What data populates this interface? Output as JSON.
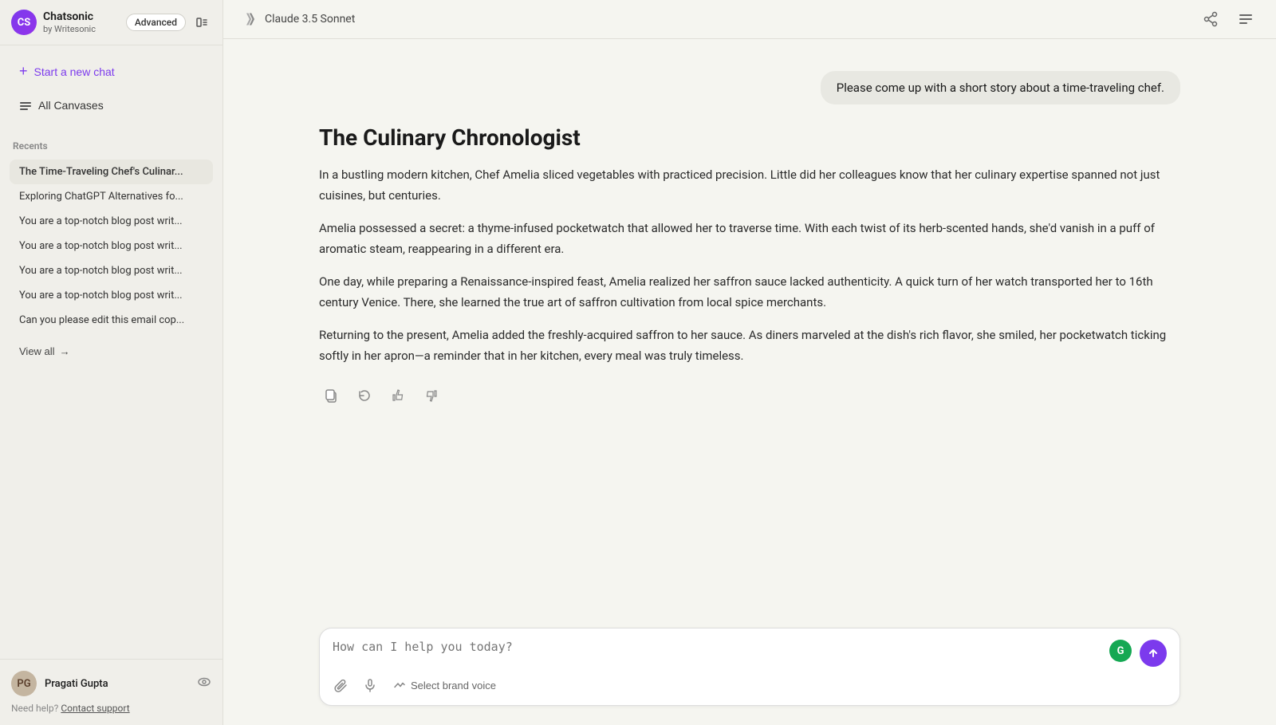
{
  "sidebar": {
    "logo_initials": "CS",
    "app_name": "Chatsonic",
    "app_by": "by Writesonic",
    "advanced_badge": "Advanced",
    "new_chat_label": "Start a new chat",
    "all_canvases_label": "All Canvases",
    "recents_label": "Recents",
    "recents": [
      {
        "id": "r1",
        "label": "The Time-Traveling Chef's Culinar...",
        "active": true
      },
      {
        "id": "r2",
        "label": "Exploring ChatGPT Alternatives fo...",
        "active": false
      },
      {
        "id": "r3",
        "label": "You are a top-notch blog post writ...",
        "active": false
      },
      {
        "id": "r4",
        "label": "You are a top-notch blog post writ...",
        "active": false
      },
      {
        "id": "r5",
        "label": "You are a top-notch blog post writ...",
        "active": false
      },
      {
        "id": "r6",
        "label": "You are a top-notch blog post writ...",
        "active": false
      },
      {
        "id": "r7",
        "label": "Can you please edit this email cop...",
        "active": false
      }
    ],
    "view_all_label": "View all",
    "user_name": "Pragati Gupta",
    "user_initials": "PG",
    "need_help_text": "Need help?",
    "contact_support": "Contact support"
  },
  "header": {
    "model_name": "Claude 3.5 Sonnet"
  },
  "chat": {
    "user_message": "Please come up with a short story about a time-traveling chef.",
    "story_title": "The Culinary Chronologist",
    "paragraphs": [
      "In a bustling modern kitchen, Chef Amelia sliced vegetables with practiced precision. Little did her colleagues know that her culinary expertise spanned not just cuisines, but centuries.",
      "Amelia possessed a secret: a thyme-infused pocketwatch that allowed her to traverse time. With each twist of its herb-scented hands, she'd vanish in a puff of aromatic steam, reappearing in a different era.",
      "One day, while preparing a Renaissance-inspired feast, Amelia realized her saffron sauce lacked authenticity. A quick turn of her watch transported her to 16th century Venice. There, she learned the true art of saffron cultivation from local spice merchants.",
      "Returning to the present, Amelia added the freshly-acquired saffron to her sauce. As diners marveled at the dish's rich flavor, she smiled, her pocketwatch ticking softly in her apron—a reminder that in her kitchen, every meal was truly timeless."
    ]
  },
  "input": {
    "placeholder": "How can I help you today?",
    "brand_voice_label": "Select brand voice"
  }
}
